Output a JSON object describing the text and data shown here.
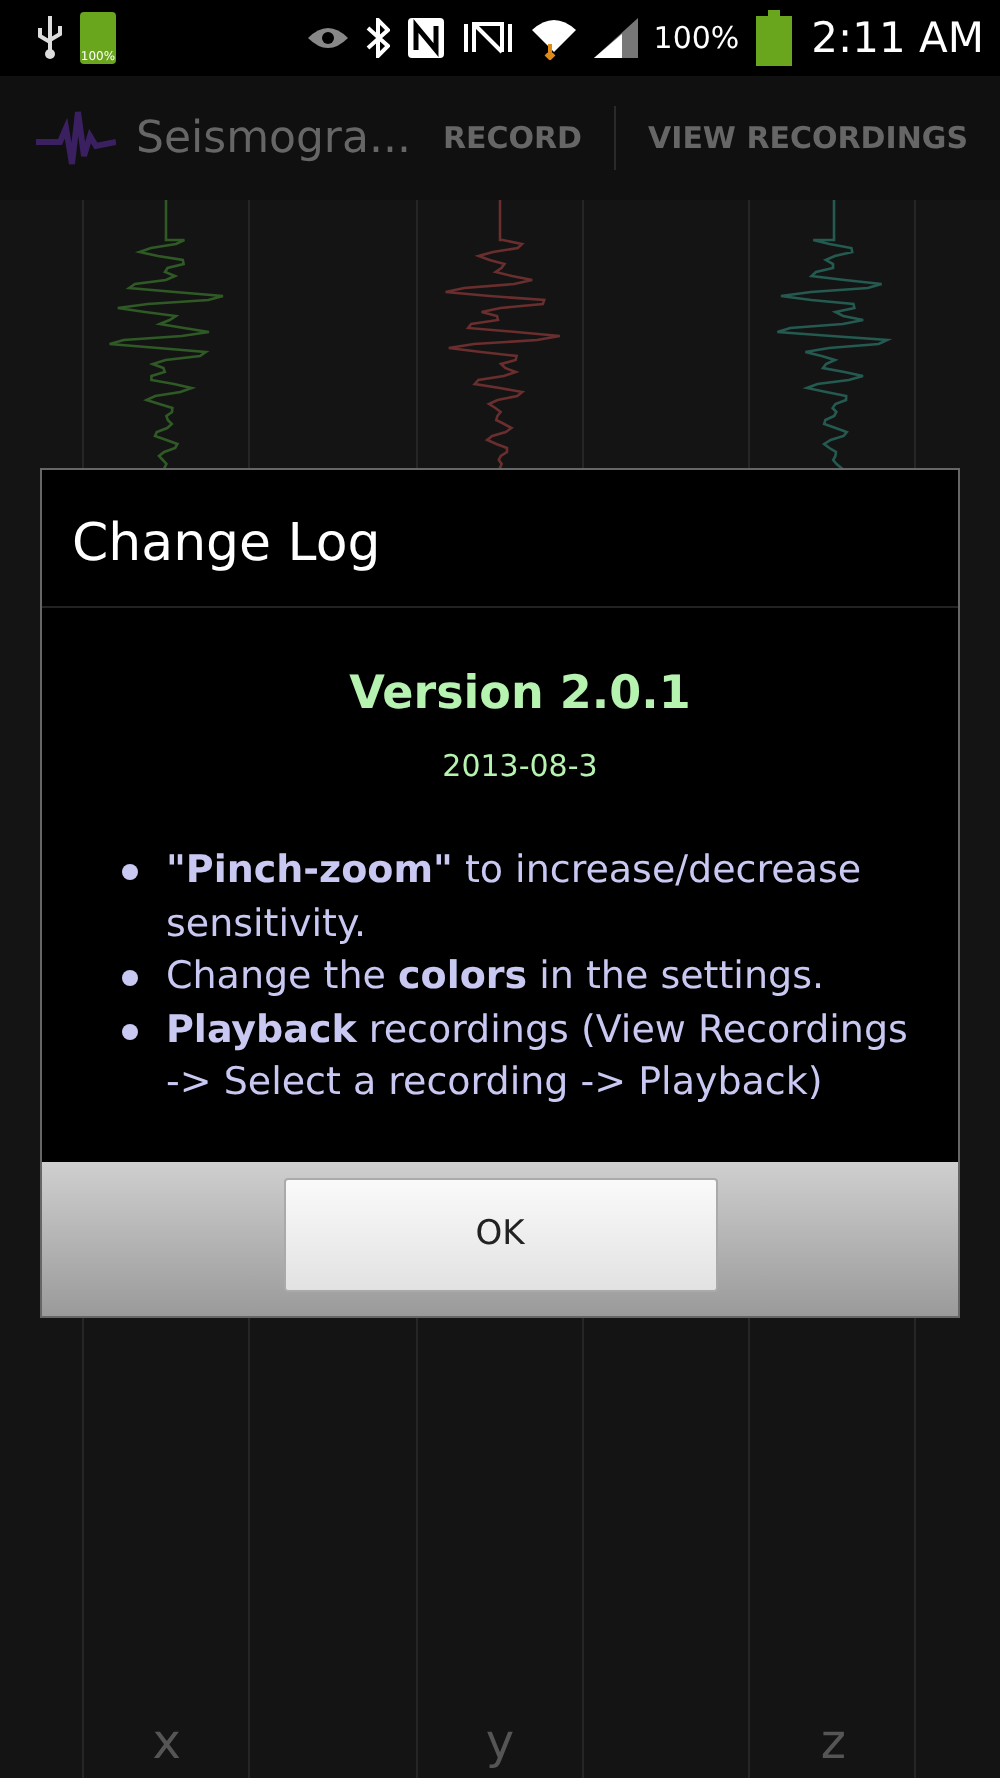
{
  "status_bar": {
    "battery_label": "100%",
    "battery_percent": "100%",
    "time": "2:11 AM"
  },
  "action_bar": {
    "title": "Seismogra...",
    "actions": [
      "RECORD",
      "VIEW RECORDINGS"
    ]
  },
  "axes": [
    {
      "label": "x",
      "color": "#2f5a25"
    },
    {
      "label": "y",
      "color": "#6a2e2e"
    },
    {
      "label": "z",
      "color": "#245a50"
    }
  ],
  "dialog": {
    "title": "Change Log",
    "version": "Version 2.0.1",
    "date": "2013-08-3",
    "items": [
      "**\"Pinch-zoom\"** to increase/decrease sensitivity.",
      "Change the **colors** in the settings.",
      "**Playback** recordings (View Recordings -> Select a recording -> Playback)"
    ],
    "button": "OK"
  }
}
